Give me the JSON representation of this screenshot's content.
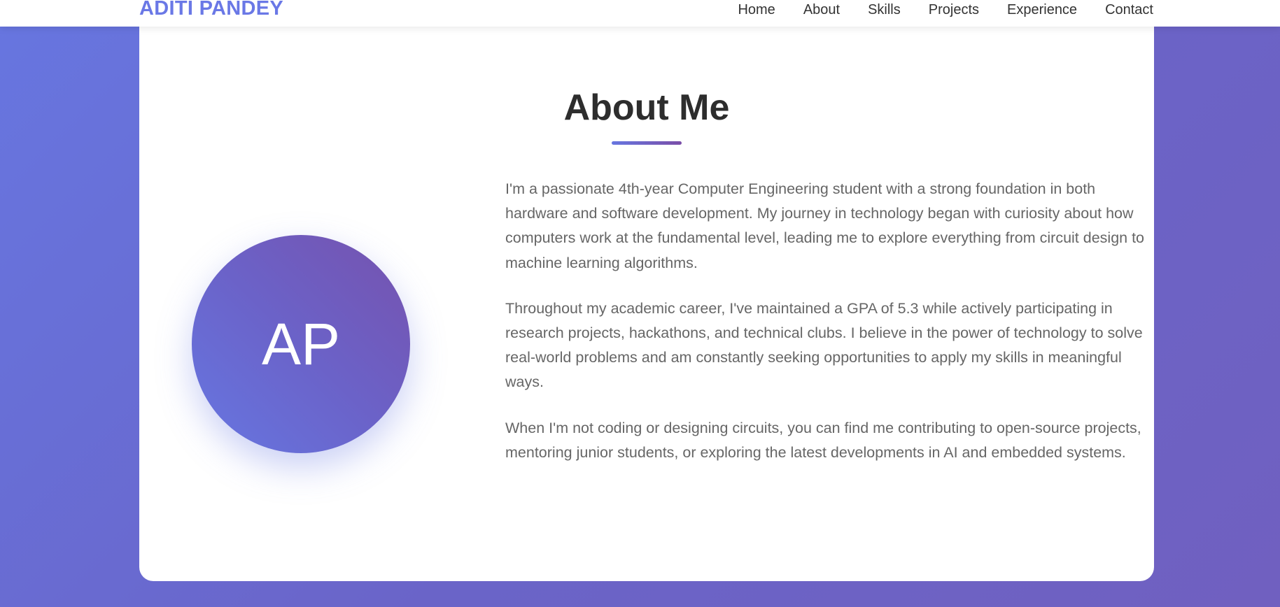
{
  "nav": {
    "logo": "ADITI PANDEY",
    "links": [
      "Home",
      "About",
      "Skills",
      "Projects",
      "Experience",
      "Contact"
    ]
  },
  "about": {
    "title": "About Me",
    "avatar_initials": "AP",
    "paragraphs": [
      "I'm a passionate 4th-year Computer Engineering student with a strong foundation in both hardware and software development. My journey in technology began with curiosity about how computers work at the fundamental level, leading me to explore everything from circuit design to machine learning algorithms.",
      "Throughout my academic career, I've maintained a GPA of 5.3 while actively participating in research projects, hackathons, and technical clubs. I believe in the power of technology to solve real-world problems and am constantly seeking opportunities to apply my skills in meaningful ways.",
      "When I'm not coding or designing circuits, you can find me contributing to open-source projects, mentoring junior students, or exploring the latest developments in AI and embedded systems."
    ]
  },
  "colors": {
    "accent": "#6a78e6",
    "accent_purple": "#764ba2",
    "background_gradient_start": "#6776e0",
    "background_gradient_end": "#7060c0",
    "heading": "#2d2d2d",
    "body_text": "#666666"
  }
}
